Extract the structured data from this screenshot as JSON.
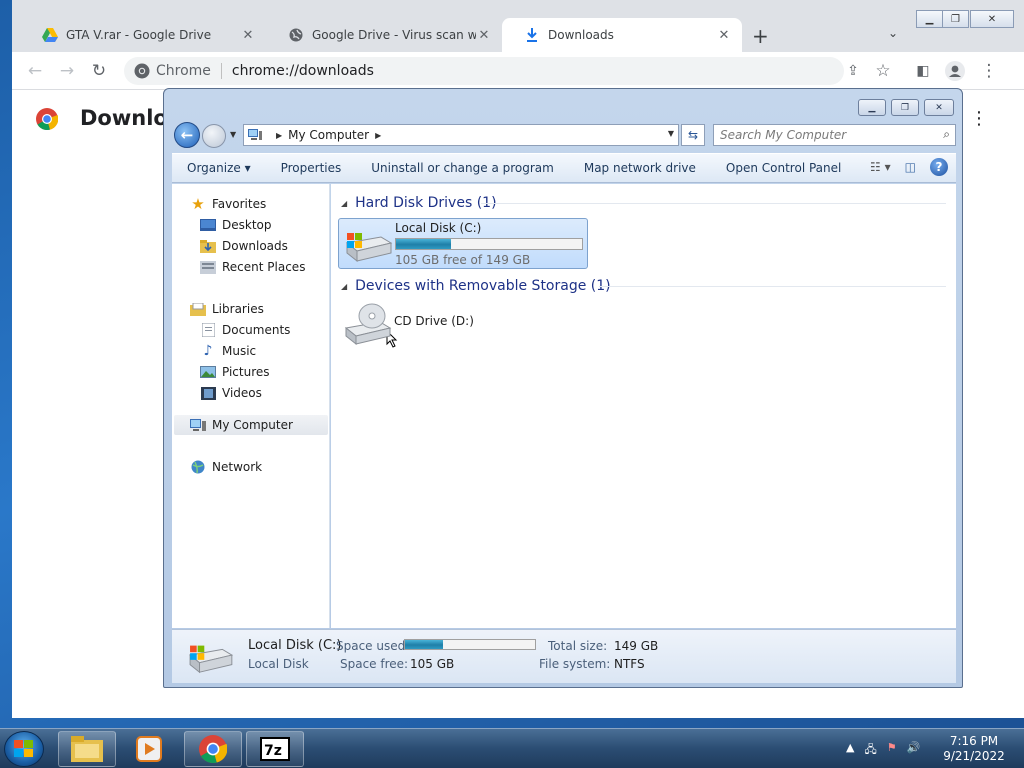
{
  "chrome": {
    "tabs": [
      {
        "title": "GTA V.rar - Google Drive",
        "icon": "google-drive-icon"
      },
      {
        "title": "Google Drive - Virus scan warning",
        "icon": "globe-icon"
      },
      {
        "title": "Downloads",
        "icon": "download-icon",
        "active": true
      }
    ],
    "omnibox": {
      "site_label": "Chrome",
      "url": "chrome://downloads"
    },
    "page_title": "Downloads"
  },
  "explorer": {
    "address": {
      "location": "My Computer"
    },
    "search_placeholder": "Search My Computer",
    "commands": [
      "Organize",
      "Properties",
      "Uninstall or change a program",
      "Map network drive",
      "Open Control Panel"
    ],
    "nav": {
      "favorites": "Favorites",
      "desktop": "Desktop",
      "downloads": "Downloads",
      "recent": "Recent Places",
      "libraries": "Libraries",
      "documents": "Documents",
      "music": "Music",
      "pictures": "Pictures",
      "videos": "Videos",
      "my_computer": "My Computer",
      "network": "Network"
    },
    "groups": {
      "hdd": "Hard Disk Drives (1)",
      "removable": "Devices with Removable Storage (1)"
    },
    "drives": {
      "c": {
        "name": "Local Disk (C:)",
        "free_text": "105 GB free of 149 GB",
        "used_fraction": 0.295
      },
      "d": {
        "name": "CD Drive (D:)"
      }
    },
    "details": {
      "name": "Local Disk (C:)",
      "type": "Local Disk",
      "space_used_label": "Space used:",
      "space_free_label": "Space free:",
      "space_free": "105 GB",
      "total_size_label": "Total size:",
      "total_size": "149 GB",
      "fs_label": "File system:",
      "fs": "NTFS"
    }
  },
  "taskbar": {
    "time": "7:16 PM",
    "date": "9/21/2022"
  }
}
